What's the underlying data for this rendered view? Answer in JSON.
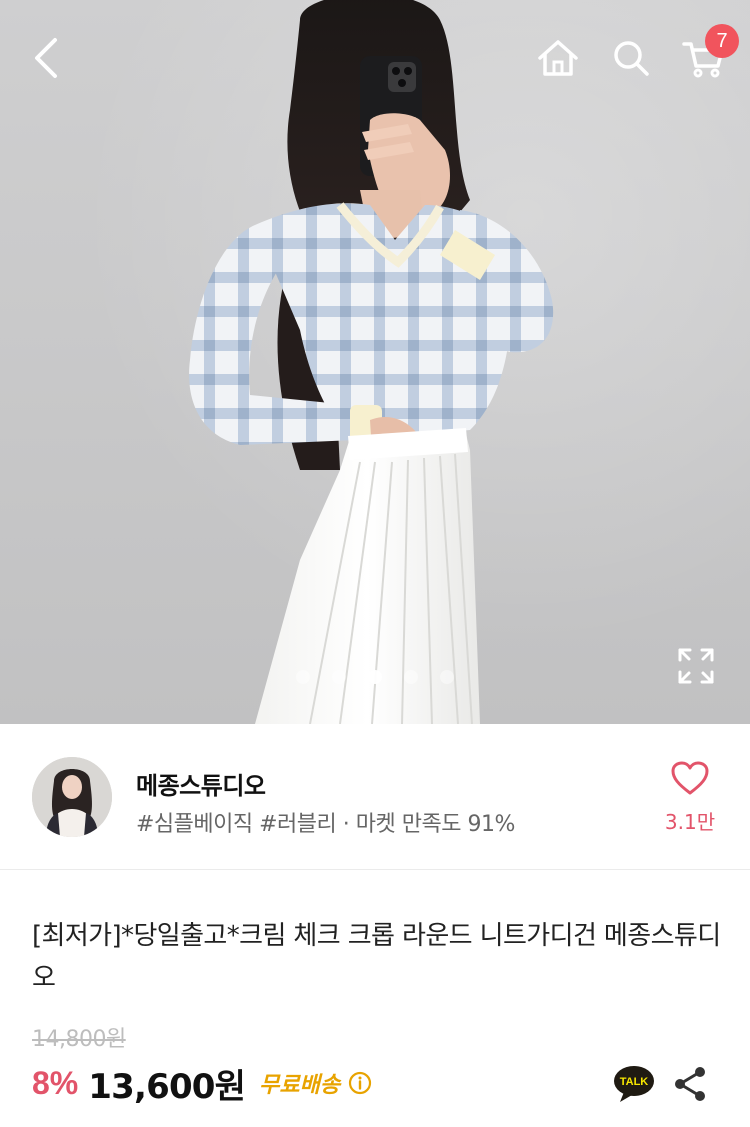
{
  "header": {
    "cart_count": "7",
    "icons": [
      "back-arrow-icon",
      "home-icon",
      "search-icon",
      "cart-icon"
    ]
  },
  "gallery": {
    "image_count": 5,
    "active_index": 3,
    "expand_icon": "expand-icon"
  },
  "seller": {
    "name": "메종스튜디오",
    "tags": "#심플베이직 #러블리 · 마켓 만족도 91%",
    "like_count": "3.1만"
  },
  "product": {
    "title": "[최저가]*당일출고*크림 체크 크롭 라운드 니트가디건 메종스튜디오",
    "original_price": "14,800원",
    "discount": "8%",
    "price": "13,600원",
    "shipping": "무료배송",
    "talk_label": "TALK"
  },
  "colors": {
    "accent_pink": "#e2546a",
    "badge_red": "#f1545d",
    "shipping_yellow": "#e8a300"
  }
}
